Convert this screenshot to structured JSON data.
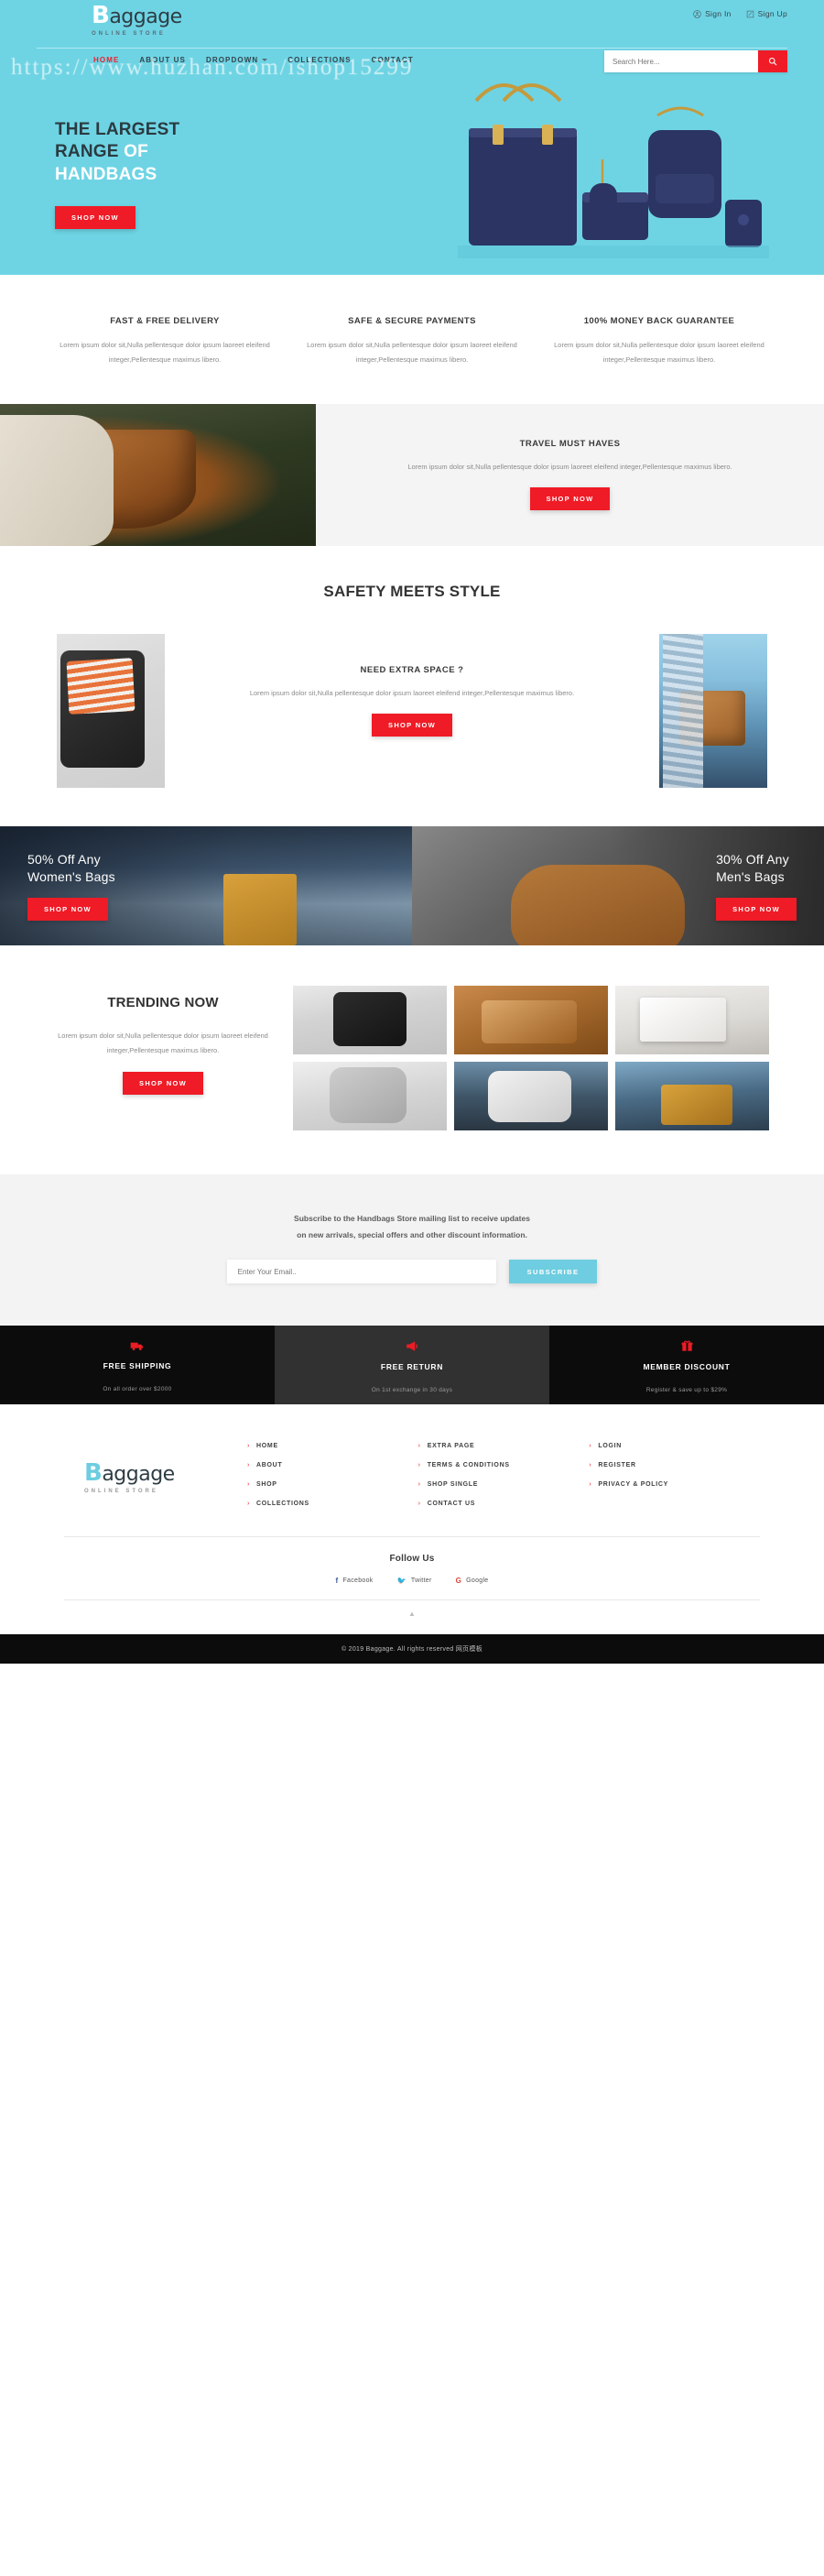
{
  "brand": {
    "cap": "B",
    "rest": "aggage",
    "tagline": "ONLINE STORE"
  },
  "header": {
    "account": [
      {
        "label": "Sign In",
        "icon": "user-icon"
      },
      {
        "label": "Sign Up",
        "icon": "edit-icon"
      }
    ],
    "nav": [
      {
        "label": "HOME",
        "active": true
      },
      {
        "label": "ABOUT US",
        "active": false
      },
      {
        "label": "DROPDOWN",
        "active": false,
        "caret": true
      },
      {
        "label": "COLLECTIONS",
        "active": false
      },
      {
        "label": "CONTACT",
        "active": false
      }
    ],
    "search": {
      "placeholder": "Search Here...",
      "value": "",
      "button_icon": "search-icon"
    }
  },
  "watermark": "https://www.huzhan.com/ishop15299",
  "hero": {
    "line1": "THE LARGEST",
    "line2a": "RANGE ",
    "line2b": "OF",
    "line3": "HANDBAGS",
    "cta": "SHOP NOW"
  },
  "features": [
    {
      "title": "FAST & FREE DELIVERY",
      "body": "Lorem ipsum dolor sit,Nulla pellentesque dolor ipsum laoreet eleifend integer,Pellentesque maximus libero."
    },
    {
      "title": "SAFE & SECURE PAYMENTS",
      "body": "Lorem ipsum dolor sit,Nulla pellentesque dolor ipsum laoreet eleifend integer,Pellentesque maximus libero."
    },
    {
      "title": "100% MONEY BACK GUARANTEE",
      "body": "Lorem ipsum dolor sit,Nulla pellentesque dolor ipsum laoreet eleifend integer,Pellentesque maximus libero."
    }
  ],
  "travel": {
    "title": "TRAVEL MUST HAVES",
    "body": "Lorem ipsum dolor sit,Nulla pellentesque dolor ipsum laoreet eleifend integer,Pellentesque maximus libero.",
    "cta": "SHOP NOW"
  },
  "safety": {
    "title": "SAFETY MEETS STYLE",
    "card_title": "NEED EXTRA SPACE ?",
    "card_body": "Lorem ipsum dolor sit,Nulla pellentesque dolor ipsum laoreet eleifend integer,Pellentesque maximus libero.",
    "cta": "SHOP NOW"
  },
  "promos": [
    {
      "line1": "50% Off Any",
      "line2": "Women's Bags",
      "cta": "SHOP NOW"
    },
    {
      "line1": "30% Off Any",
      "line2": "Men's Bags",
      "cta": "SHOP NOW"
    }
  ],
  "trending": {
    "title": "TRENDING NOW",
    "body": "Lorem ipsum dolor sit,Nulla pellentesque dolor ipsum laoreet eleifend integer,Pellentesque maximus libero.",
    "cta": "SHOP NOW"
  },
  "newsletter": {
    "line1": "Subscribe to the Handbags Store mailing list to receive updates",
    "line2": "on new arrivals, special offers and other discount information.",
    "placeholder": "Enter Your Email..",
    "value": "",
    "cta": "SUBSCRIBE"
  },
  "services": [
    {
      "icon": "truck-icon",
      "glyph": "🚚",
      "title": "FREE SHIPPING",
      "sub": "On all order over $2000"
    },
    {
      "icon": "megaphone-icon",
      "glyph": "📣",
      "title": "FREE RETURN",
      "sub": "On 1st exchange in 30 days"
    },
    {
      "icon": "gift-icon",
      "glyph": "🎁",
      "title": "MEMBER DISCOUNT",
      "sub": "Register & save up to $29%"
    }
  ],
  "footer": {
    "columns": [
      {
        "links": [
          "HOME",
          "ABOUT",
          "SHOP",
          "COLLECTIONS"
        ]
      },
      {
        "links": [
          "EXTRA PAGE",
          "TERMS & CONDITIONS",
          "SHOP SINGLE",
          "CONTACT US"
        ]
      },
      {
        "links": [
          "LOGIN",
          "REGISTER",
          "PRIVACY & POLICY"
        ]
      }
    ],
    "follow_title": "Follow Us",
    "socials": [
      {
        "label": "Facebook",
        "glyph": "f",
        "color": "#3b5998"
      },
      {
        "label": "Twitter",
        "glyph": "t",
        "color": "#1da1f2"
      },
      {
        "label": "Google",
        "glyph": "G",
        "color": "#db4437"
      }
    ],
    "to_top": "▲",
    "copyright": "© 2019 Baggage. All rights reserved 网页模板"
  },
  "colors": {
    "hero_bg": "#6ed4e4",
    "accent_red": "#ef1b26",
    "accent_cyan": "#6ecde0",
    "dark": "#0c0c0c"
  }
}
